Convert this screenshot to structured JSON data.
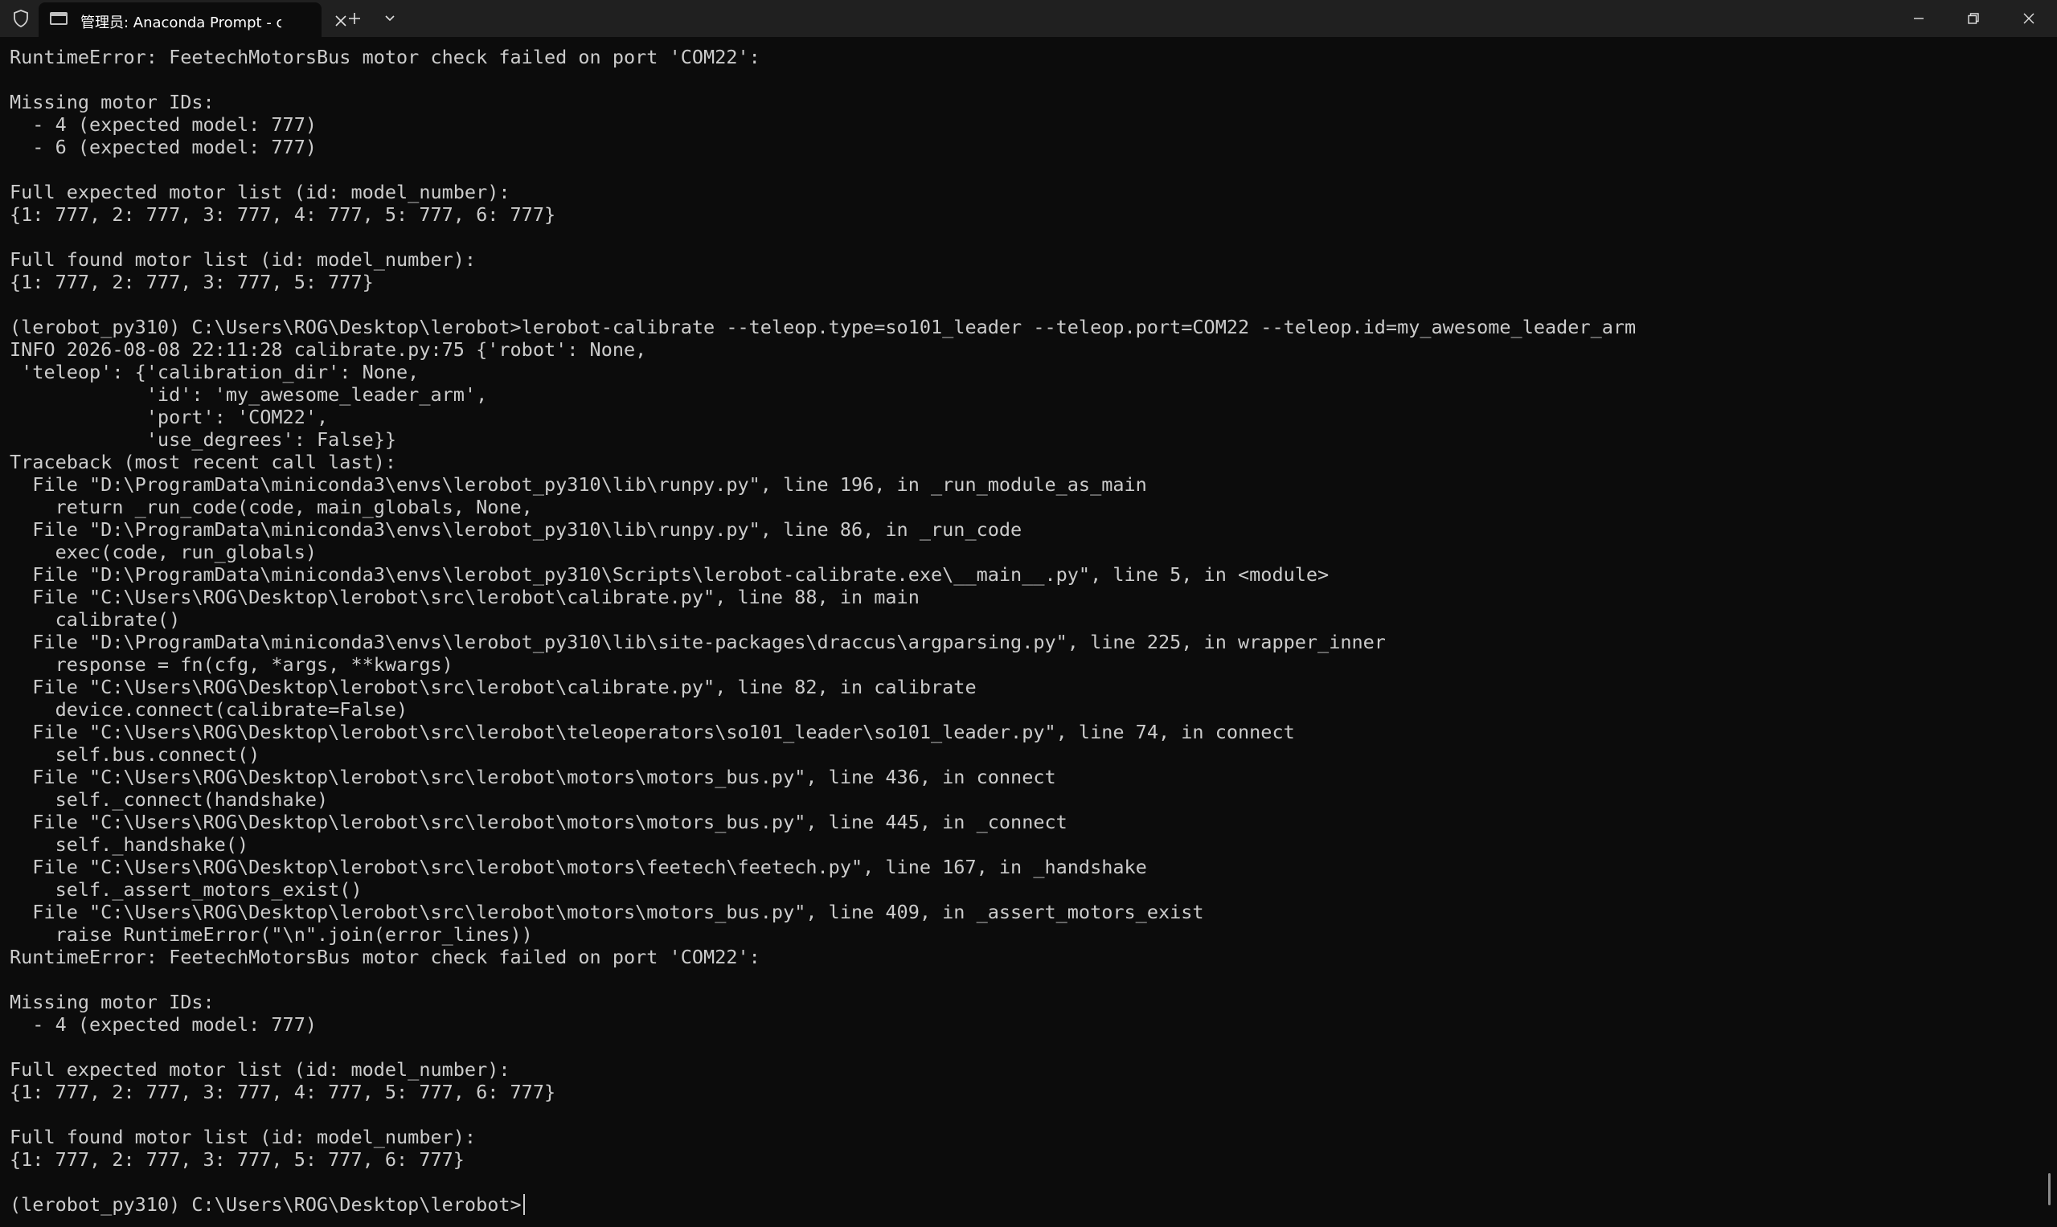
{
  "titlebar": {
    "tab_title": "管理员: Anaconda Prompt - cc",
    "icons": {
      "shield": "shield-icon",
      "tab": "terminal-icon",
      "tab_close": "close-icon",
      "new_tab": "plus-icon",
      "dropdown": "chevron-down-icon",
      "minimize": "minimize-icon",
      "restore": "restore-icon",
      "close": "close-icon"
    }
  },
  "console": {
    "lines": [
      "RuntimeError: FeetechMotorsBus motor check failed on port 'COM22':",
      "",
      "Missing motor IDs:",
      "  - 4 (expected model: 777)",
      "  - 6 (expected model: 777)",
      "",
      "Full expected motor list (id: model_number):",
      "{1: 777, 2: 777, 3: 777, 4: 777, 5: 777, 6: 777}",
      "",
      "Full found motor list (id: model_number):",
      "{1: 777, 2: 777, 3: 777, 5: 777}",
      "",
      "(lerobot_py310) C:\\Users\\ROG\\Desktop\\lerobot>lerobot-calibrate --teleop.type=so101_leader --teleop.port=COM22 --teleop.id=my_awesome_leader_arm",
      "INFO 2026-08-08 22:11:28 calibrate.py:75 {'robot': None,",
      " 'teleop': {'calibration_dir': None,",
      "            'id': 'my_awesome_leader_arm',",
      "            'port': 'COM22',",
      "            'use_degrees': False}}",
      "Traceback (most recent call last):",
      "  File \"D:\\ProgramData\\miniconda3\\envs\\lerobot_py310\\lib\\runpy.py\", line 196, in _run_module_as_main",
      "    return _run_code(code, main_globals, None,",
      "  File \"D:\\ProgramData\\miniconda3\\envs\\lerobot_py310\\lib\\runpy.py\", line 86, in _run_code",
      "    exec(code, run_globals)",
      "  File \"D:\\ProgramData\\miniconda3\\envs\\lerobot_py310\\Scripts\\lerobot-calibrate.exe\\__main__.py\", line 5, in <module>",
      "  File \"C:\\Users\\ROG\\Desktop\\lerobot\\src\\lerobot\\calibrate.py\", line 88, in main",
      "    calibrate()",
      "  File \"D:\\ProgramData\\miniconda3\\envs\\lerobot_py310\\lib\\site-packages\\draccus\\argparsing.py\", line 225, in wrapper_inner",
      "    response = fn(cfg, *args, **kwargs)",
      "  File \"C:\\Users\\ROG\\Desktop\\lerobot\\src\\lerobot\\calibrate.py\", line 82, in calibrate",
      "    device.connect(calibrate=False)",
      "  File \"C:\\Users\\ROG\\Desktop\\lerobot\\src\\lerobot\\teleoperators\\so101_leader\\so101_leader.py\", line 74, in connect",
      "    self.bus.connect()",
      "  File \"C:\\Users\\ROG\\Desktop\\lerobot\\src\\lerobot\\motors\\motors_bus.py\", line 436, in connect",
      "    self._connect(handshake)",
      "  File \"C:\\Users\\ROG\\Desktop\\lerobot\\src\\lerobot\\motors\\motors_bus.py\", line 445, in _connect",
      "    self._handshake()",
      "  File \"C:\\Users\\ROG\\Desktop\\lerobot\\src\\lerobot\\motors\\feetech\\feetech.py\", line 167, in _handshake",
      "    self._assert_motors_exist()",
      "  File \"C:\\Users\\ROG\\Desktop\\lerobot\\src\\lerobot\\motors\\motors_bus.py\", line 409, in _assert_motors_exist",
      "    raise RuntimeError(\"\\n\".join(error_lines))",
      "RuntimeError: FeetechMotorsBus motor check failed on port 'COM22':",
      "",
      "Missing motor IDs:",
      "  - 4 (expected model: 777)",
      "",
      "Full expected motor list (id: model_number):",
      "{1: 777, 2: 777, 3: 777, 4: 777, 5: 777, 6: 777}",
      "",
      "Full found motor list (id: model_number):",
      "{1: 777, 2: 777, 3: 777, 5: 777, 6: 777}",
      ""
    ],
    "prompt": "(lerobot_py310) C:\\Users\\ROG\\Desktop\\lerobot>"
  },
  "colors": {
    "background": "#0c0c0c",
    "titlebar": "#202020",
    "text": "#cccccc"
  }
}
